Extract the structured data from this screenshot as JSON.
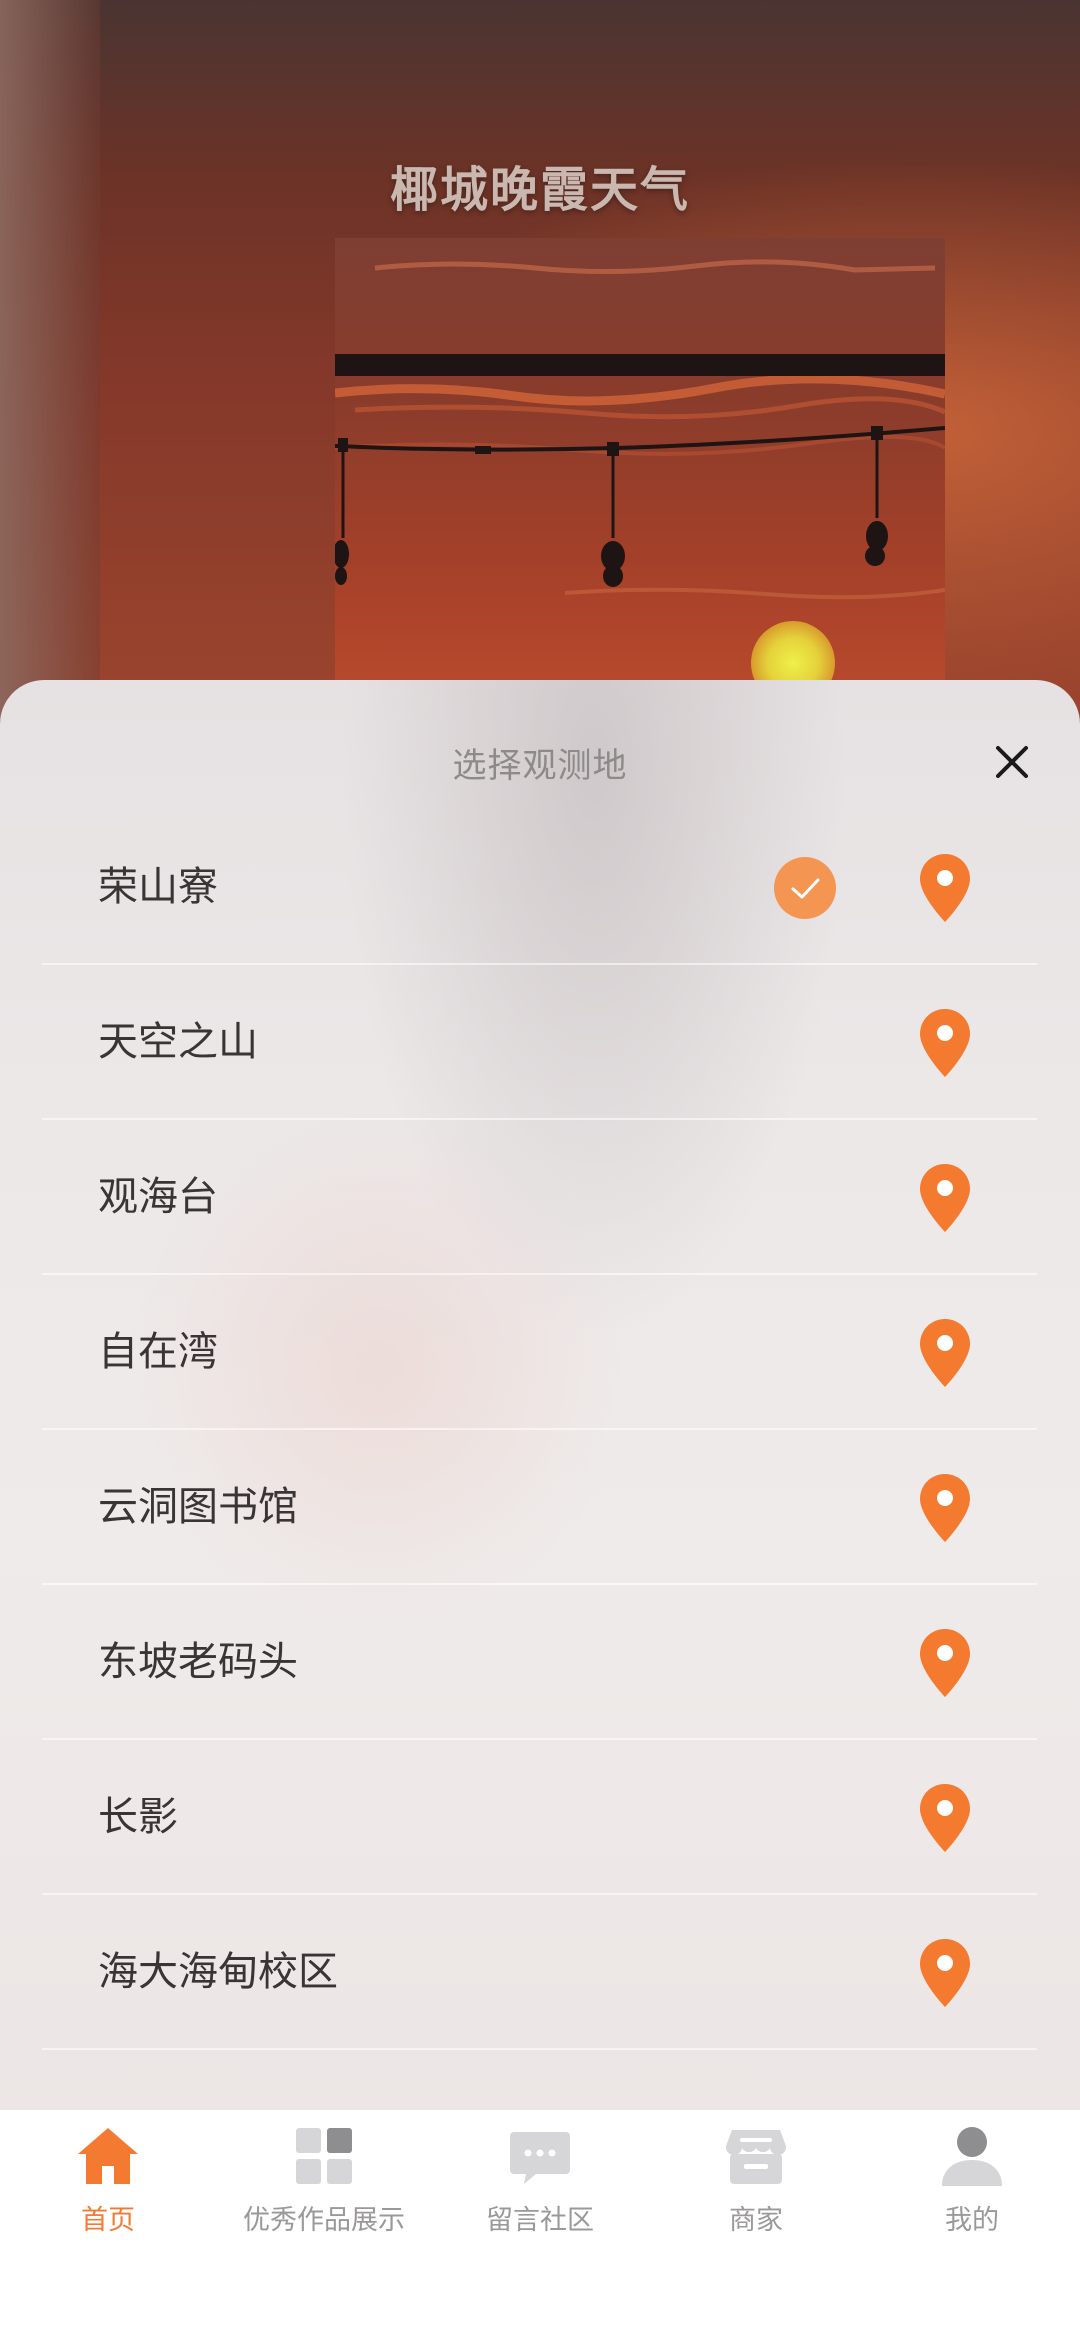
{
  "background": {
    "title": "椰城晚霞天气"
  },
  "sheet": {
    "title": "选择观测地",
    "close_icon": "close-icon",
    "accent_color": "#f37a2f",
    "locations": [
      {
        "name": "荣山寮",
        "selected": true
      },
      {
        "name": "天空之山",
        "selected": false
      },
      {
        "name": "观海台",
        "selected": false
      },
      {
        "name": "自在湾",
        "selected": false
      },
      {
        "name": "云洞图书馆",
        "selected": false
      },
      {
        "name": "东坡老码头",
        "selected": false
      },
      {
        "name": "长影",
        "selected": false
      },
      {
        "name": "海大海甸校区",
        "selected": false
      }
    ]
  },
  "tabbar": {
    "active_color": "#f47a32",
    "inactive_color": "#9a9898",
    "tabs": [
      {
        "label": "首页",
        "icon": "home-icon",
        "active": true
      },
      {
        "label": "优秀作品展示",
        "icon": "grid-icon",
        "active": false
      },
      {
        "label": "留言社区",
        "icon": "chat-icon",
        "active": false
      },
      {
        "label": "商家",
        "icon": "store-icon",
        "active": false
      },
      {
        "label": "我的",
        "icon": "user-icon",
        "active": false
      }
    ]
  }
}
